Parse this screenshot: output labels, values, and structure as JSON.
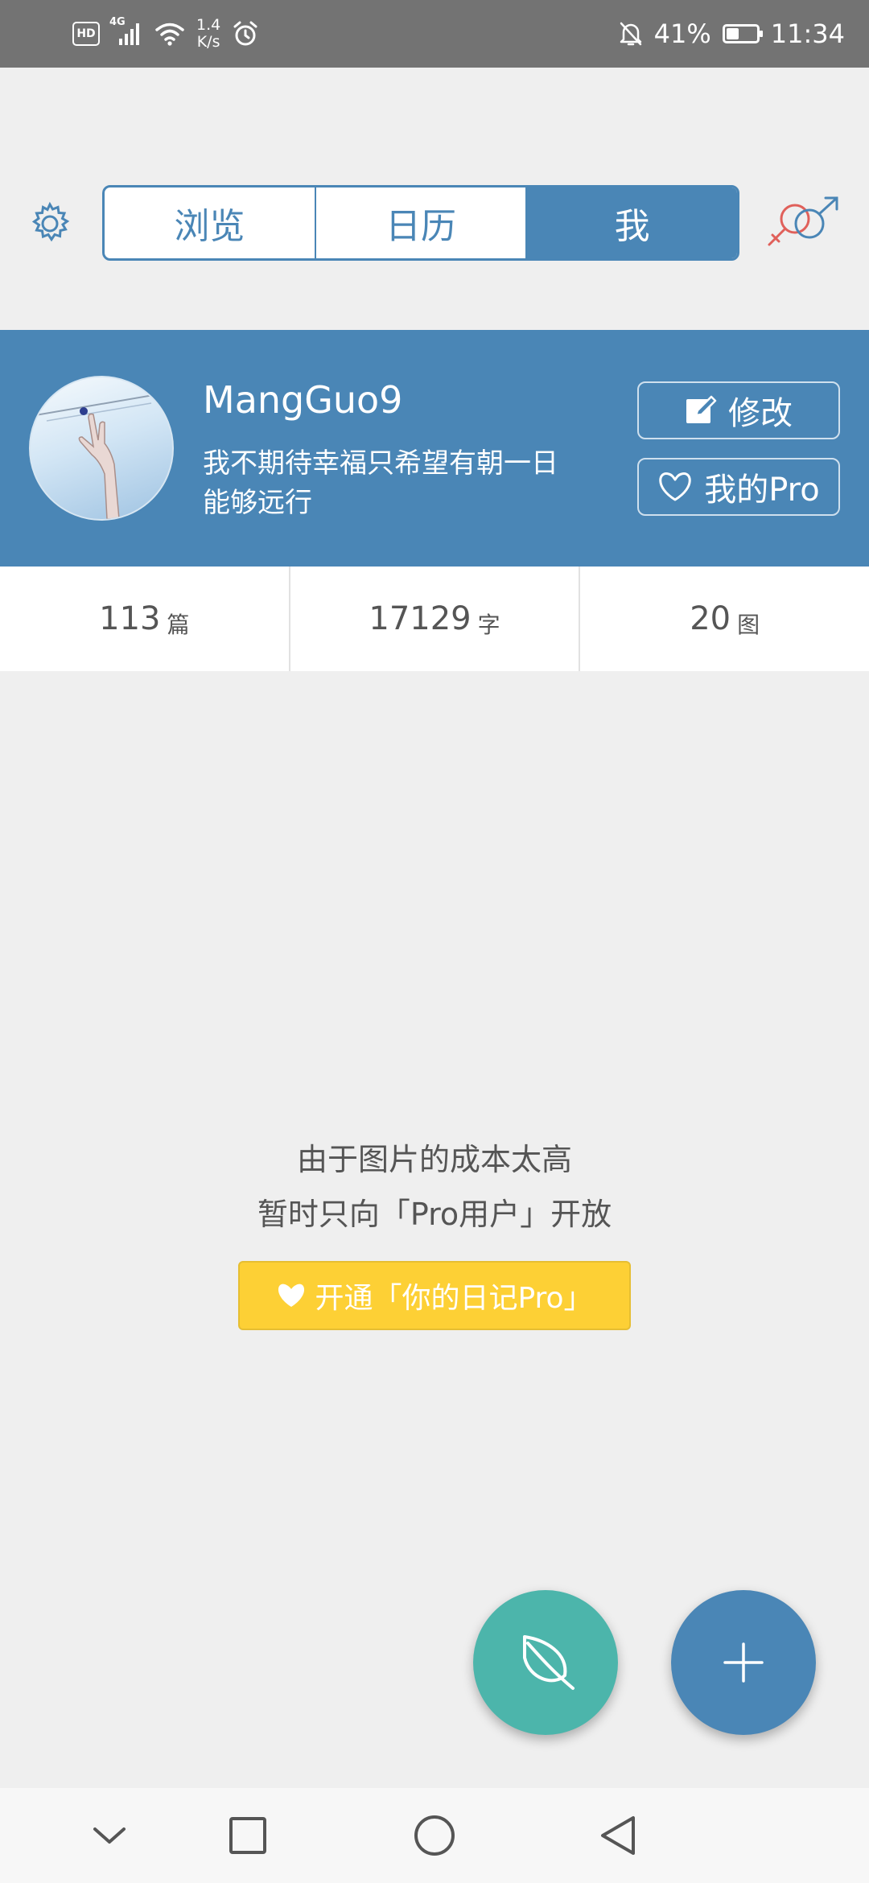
{
  "status_bar": {
    "hd_label": "HD",
    "network_type": "4G",
    "speed_value": "1.4",
    "speed_unit": "K/s",
    "battery_percent": "41%",
    "battery_level": 0.41,
    "time": "11:34"
  },
  "header": {
    "tabs": [
      {
        "label": "浏览",
        "active": false
      },
      {
        "label": "日历",
        "active": false
      },
      {
        "label": "我",
        "active": true
      }
    ],
    "accent_color": "#4a86b6"
  },
  "profile": {
    "username": "MangGuo9",
    "bio_line1": "我不期待幸福只希望有朝一日",
    "bio_line2": "能够远行",
    "edit_label": "修改",
    "pro_label": "我的Pro"
  },
  "stats": [
    {
      "value": "113",
      "unit": "篇"
    },
    {
      "value": "17129",
      "unit": "字"
    },
    {
      "value": "20",
      "unit": "图"
    }
  ],
  "empty_message": {
    "line1": "由于图片的成本太高",
    "line2": "暂时只向「Pro用户」开放",
    "button_label": "开通「你的日记Pro」",
    "button_color": "#fdd035"
  },
  "fabs": {
    "leaf_color": "#4cb5ab",
    "add_color": "#4a86b6"
  },
  "icons": {
    "settings": "gear-icon",
    "gender": "gender-icon",
    "edit": "edit-icon",
    "heart": "heart-icon",
    "leaf": "leaf-icon",
    "add": "plus-icon"
  }
}
